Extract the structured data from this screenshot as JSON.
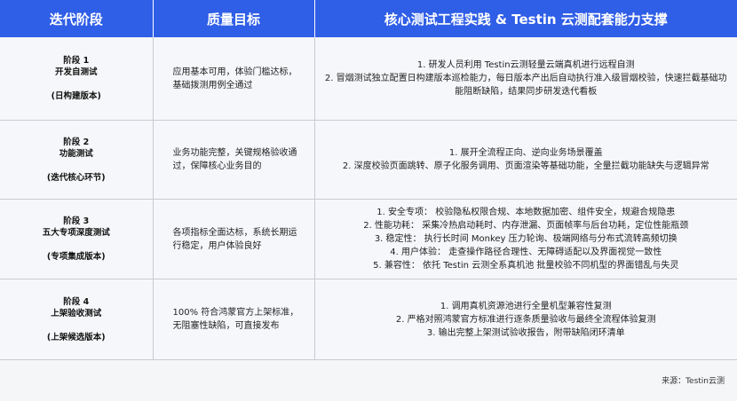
{
  "header": {
    "col1": "迭代阶段",
    "col2": "质量目标",
    "col3": "核心测试工程实践 & Testin 云测配套能力支撑"
  },
  "rows": [
    {
      "stage_num": "阶段 1",
      "stage_name": "开发自测试",
      "stage_sub": "(日构建版本)",
      "goal": "应用基本可用，体验门槛达标，基础拨测用例全通过",
      "practices": [
        "1. 研发人员利用 Testin云测轻量云端真机进行远程自测",
        "2. 冒烟测试独立配置日构建版本巡检能力，每日版本产出后自动执行准入级冒烟校验，快速拦截基础功能阻断缺陷，结果同步研发迭代看板"
      ]
    },
    {
      "stage_num": "阶段 2",
      "stage_name": "功能测试",
      "stage_sub": "(迭代核心环节)",
      "goal": "业务功能完整，关键规格验收通过，保障核心业务目的",
      "practices": [
        "1. 展开全流程正向、逆向业务场景覆盖",
        "2. 深度校验页面跳转、原子化服务调用、页面渲染等基础功能，全量拦截功能缺失与逻辑异常"
      ]
    },
    {
      "stage_num": "阶段 3",
      "stage_name": "五大专项深度测试",
      "stage_sub": "(专项集成版本)",
      "goal": "各项指标全面达标，系统长期运行稳定，用户体验良好",
      "practices": [
        "1. 安全专项： 校验隐私权限合规、本地数据加密、组件安全，规避合规隐患",
        "2. 性能功耗： 采集冷热启动耗时、内存泄漏、页面帧率与后台功耗，定位性能瓶颈",
        "3. 稳定性： 执行长时间 Monkey 压力轮询、极端网络与分布式流转高频切换",
        "4. 用户体验： 走查操作路径合理性、无障碍适配以及界面视觉一致性",
        "5. 兼容性： 依托 Testin 云测全系真机池 批量校验不同机型的界面错乱与失灵"
      ]
    },
    {
      "stage_num": "阶段 4",
      "stage_name": "上架验收测试",
      "stage_sub": "(上架候选版本)",
      "goal": "100% 符合鸿蒙官方上架标准，无阻塞性缺陷，可直接发布",
      "practices": [
        "1. 调用真机资源池进行全量机型兼容性复测",
        "2. 严格对照鸿蒙官方标准进行逐条质量验收与最终全流程体验复测",
        "3. 输出完整上架测试验收报告，附带缺陷闭环清单"
      ]
    }
  ],
  "source": "来源：Testin云测",
  "watermark": "Testin云测"
}
